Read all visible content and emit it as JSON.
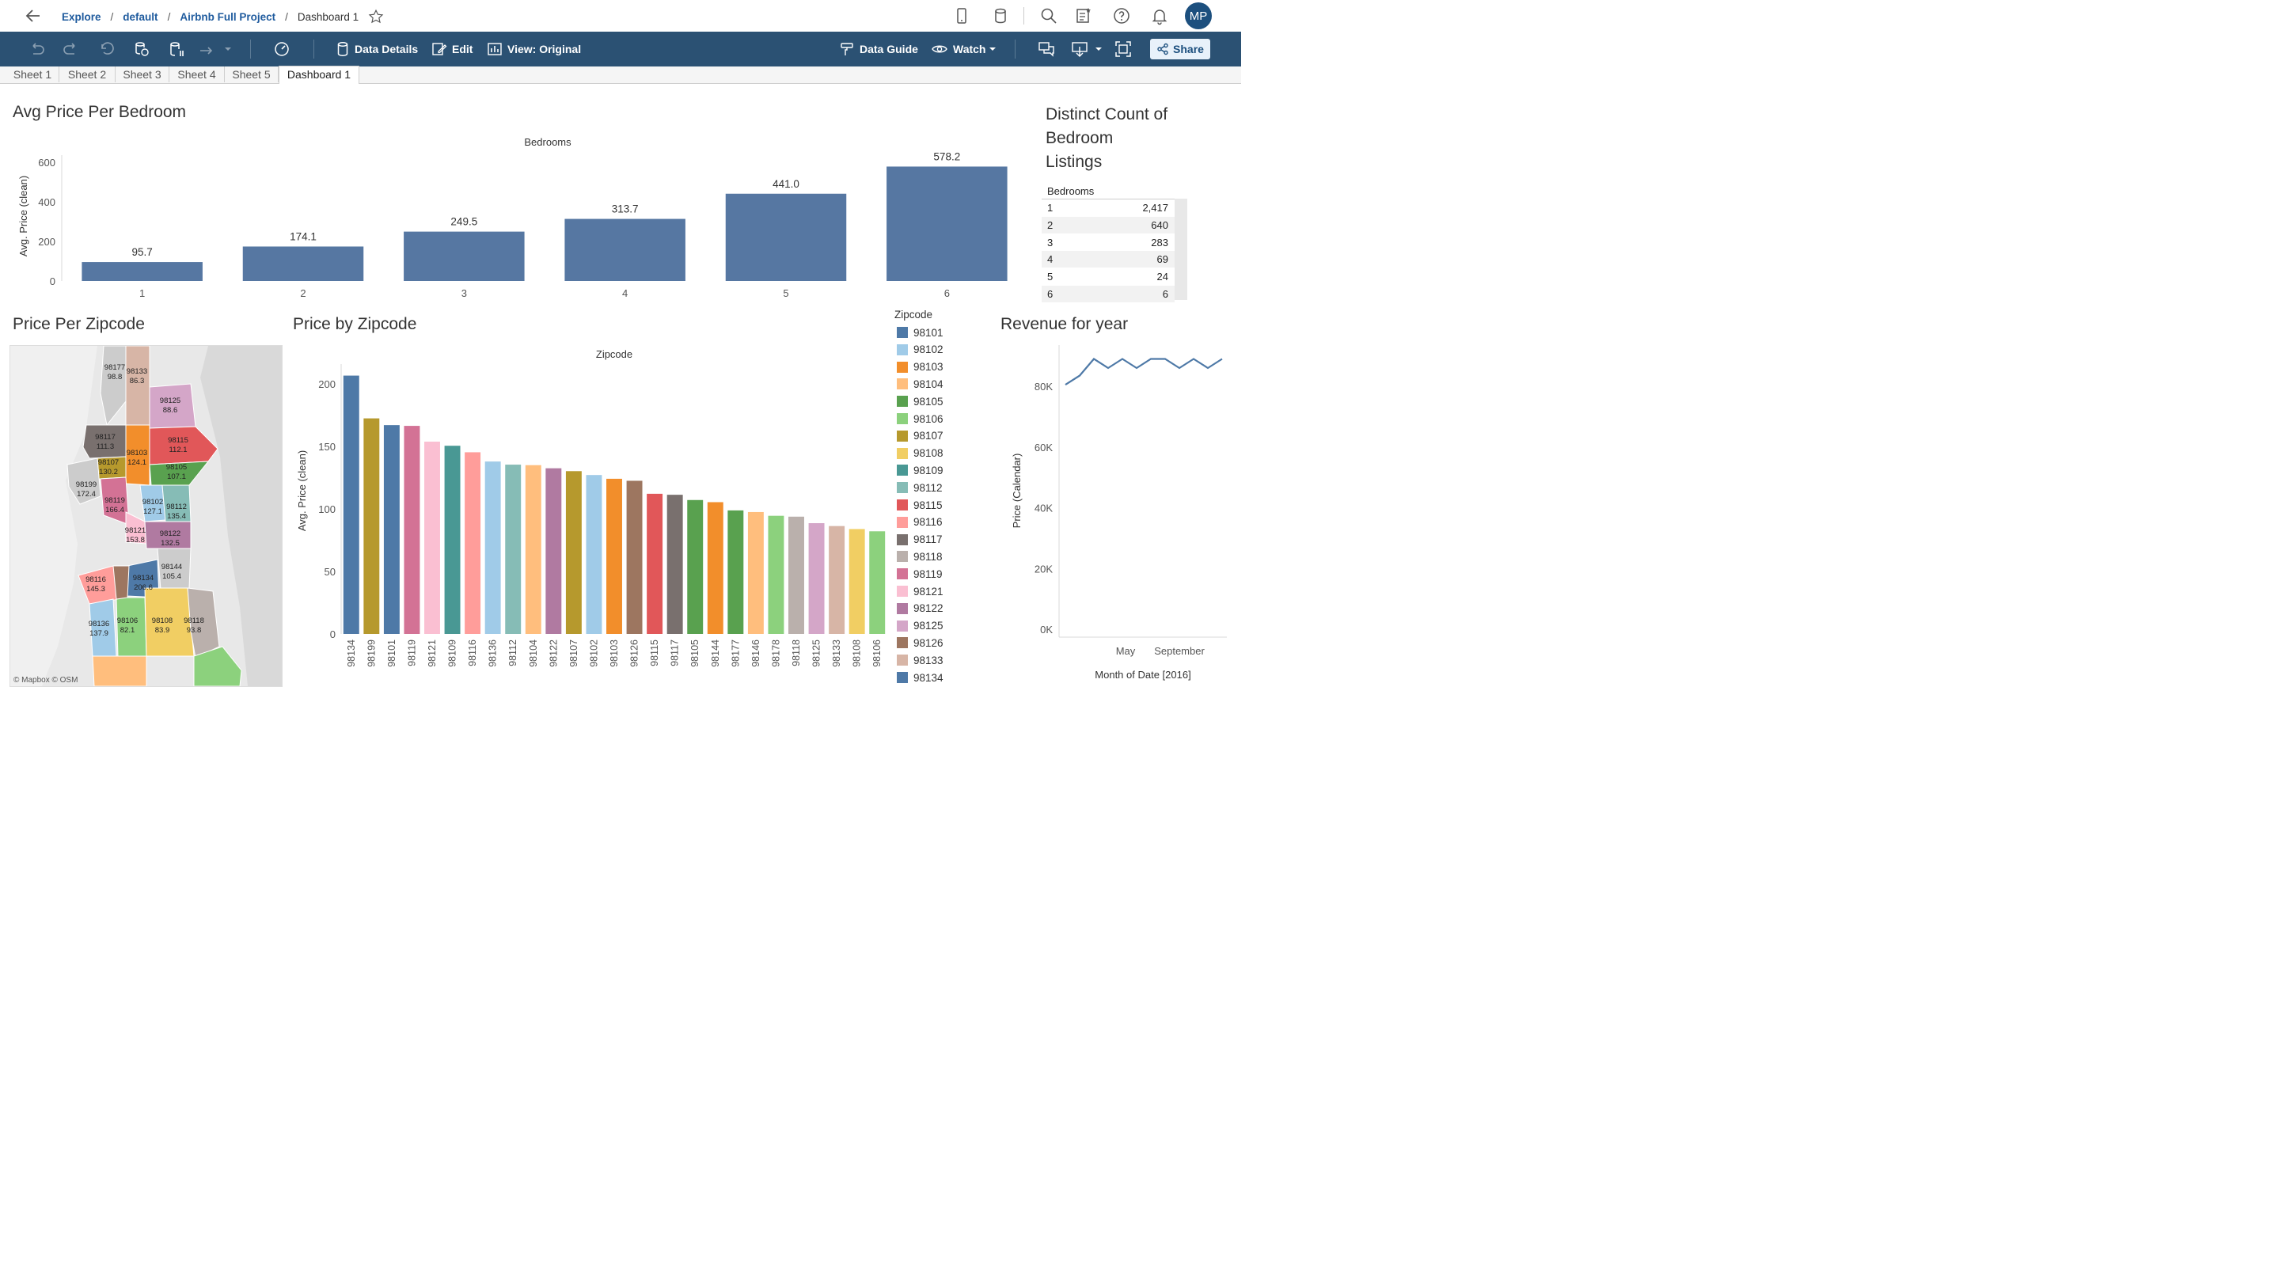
{
  "breadcrumb": {
    "items": [
      "Explore",
      "default",
      "Airbnb Full Project"
    ],
    "current": "Dashboard 1",
    "separator": "/"
  },
  "user": {
    "initials": "MP"
  },
  "toolbar": {
    "data_details": "Data Details",
    "edit": "Edit",
    "view": "View: Original",
    "data_guide": "Data Guide",
    "watch": "Watch",
    "share": "Share"
  },
  "tabs": [
    "Sheet 1",
    "Sheet 2",
    "Sheet 3",
    "Sheet 4",
    "Sheet 5",
    "Dashboard 1"
  ],
  "active_tab": "Dashboard 1",
  "titles": {
    "avg_price": "Avg Price Per Bedroom",
    "distinct_count": [
      "Distinct Count of",
      "Bedroom",
      "Listings"
    ],
    "price_per_zip": "Price Per Zipcode",
    "price_by_zip": "Price by Zipcode",
    "revenue": "Revenue for year"
  },
  "distinct_table": {
    "header": "Bedrooms",
    "rows": [
      {
        "key": "1",
        "value": "2,417"
      },
      {
        "key": "2",
        "value": "640"
      },
      {
        "key": "3",
        "value": "283"
      },
      {
        "key": "4",
        "value": "69"
      },
      {
        "key": "5",
        "value": "24"
      },
      {
        "key": "6",
        "value": "6"
      }
    ]
  },
  "legend": {
    "title": "Zipcode",
    "items": [
      {
        "zip": "98101",
        "color": "#4e79a7"
      },
      {
        "zip": "98102",
        "color": "#a0cbe8"
      },
      {
        "zip": "98103",
        "color": "#f28e2b"
      },
      {
        "zip": "98104",
        "color": "#ffbe7d"
      },
      {
        "zip": "98105",
        "color": "#59a14f"
      },
      {
        "zip": "98106",
        "color": "#8cd17d"
      },
      {
        "zip": "98107",
        "color": "#b6992d"
      },
      {
        "zip": "98108",
        "color": "#f1ce63"
      },
      {
        "zip": "98109",
        "color": "#499894"
      },
      {
        "zip": "98112",
        "color": "#86bcb6"
      },
      {
        "zip": "98115",
        "color": "#e15759"
      },
      {
        "zip": "98116",
        "color": "#ff9d9a"
      },
      {
        "zip": "98117",
        "color": "#79706e"
      },
      {
        "zip": "98118",
        "color": "#bab0ac"
      },
      {
        "zip": "98119",
        "color": "#d37295"
      },
      {
        "zip": "98121",
        "color": "#fabfd2"
      },
      {
        "zip": "98122",
        "color": "#b07aa1"
      },
      {
        "zip": "98125",
        "color": "#d4a6c8"
      },
      {
        "zip": "98126",
        "color": "#9d7660"
      },
      {
        "zip": "98133",
        "color": "#d7b5a6"
      },
      {
        "zip": "98134",
        "color": "#4e79a7"
      }
    ]
  },
  "map": {
    "credit": "© Mapbox  © OSM",
    "labels": [
      {
        "zip": "98177",
        "value": "98.8"
      },
      {
        "zip": "98133",
        "value": "86.3"
      },
      {
        "zip": "98125",
        "value": "88.6"
      },
      {
        "zip": "98117",
        "value": "111.3"
      },
      {
        "zip": "98103",
        "value": "124.1"
      },
      {
        "zip": "98115",
        "value": "112.1"
      },
      {
        "zip": "98107",
        "value": "130.2"
      },
      {
        "zip": "98105",
        "value": "107.1"
      },
      {
        "zip": "98199",
        "value": "172.4"
      },
      {
        "zip": "98119",
        "value": "166.4"
      },
      {
        "zip": "98102",
        "value": "127.1"
      },
      {
        "zip": "98112",
        "value": "135.4"
      },
      {
        "zip": "98121",
        "value": "153.8"
      },
      {
        "zip": "98122",
        "value": "132.5"
      },
      {
        "zip": "98116",
        "value": "145.3"
      },
      {
        "zip": "98134",
        "value": "206.6"
      },
      {
        "zip": "98144",
        "value": "105.4"
      },
      {
        "zip": "98136",
        "value": "137.9"
      },
      {
        "zip": "98106",
        "value": "82.1"
      },
      {
        "zip": "98108",
        "value": "83.9"
      },
      {
        "zip": "98118",
        "value": "93.8"
      }
    ]
  },
  "chart_data": [
    {
      "type": "bar",
      "title": "Avg Price Per Bedroom",
      "xlabel": "Bedrooms",
      "ylabel": "Avg. Price (clean)",
      "categories": [
        "1",
        "2",
        "3",
        "4",
        "5",
        "6"
      ],
      "values": [
        95.7,
        174.1,
        249.5,
        313.7,
        441.0,
        578.2
      ],
      "data_labels": [
        "95.7",
        "174.1",
        "249.5",
        "313.7",
        "441.0",
        "578.2"
      ],
      "yticks": [
        "0",
        "200",
        "400",
        "600"
      ],
      "ylim": [
        0,
        620
      ],
      "color": "#5677a2"
    },
    {
      "type": "bar",
      "title": "Price by Zipcode",
      "xlabel": "Zipcode",
      "ylabel": "Avg. Price (clean)",
      "categories": [
        "98134",
        "98199",
        "98101",
        "98119",
        "98121",
        "98109",
        "98116",
        "98136",
        "98112",
        "98104",
        "98122",
        "98107",
        "98102",
        "98103",
        "98126",
        "98115",
        "98117",
        "98105",
        "98144",
        "98177",
        "98146",
        "98178",
        "98118",
        "98125",
        "98133",
        "98108",
        "98106"
      ],
      "values": [
        206.6,
        172.4,
        167,
        166.4,
        153.8,
        150.5,
        145.3,
        137.9,
        135.4,
        135,
        132.5,
        130.2,
        127.1,
        124.1,
        122.5,
        112.1,
        111.3,
        107.1,
        105.4,
        98.8,
        97.5,
        94.5,
        93.8,
        88.6,
        86.3,
        83.9,
        82.1
      ],
      "colors": [
        "#4e79a7",
        "#b6992d",
        "#4e79a7",
        "#d37295",
        "#fabfd2",
        "#499894",
        "#ff9d9a",
        "#a0cbe8",
        "#86bcb6",
        "#ffbe7d",
        "#b07aa1",
        "#b6992d",
        "#a0cbe8",
        "#f28e2b",
        "#9d7660",
        "#e15759",
        "#79706e",
        "#59a14f",
        "#f28e2b",
        "#59a14f",
        "#ffbe7d",
        "#8cd17d",
        "#bab0ac",
        "#d4a6c8",
        "#d7b5a6",
        "#f1ce63",
        "#8cd17d"
      ],
      "yticks": [
        "0",
        "50",
        "100",
        "150",
        "200"
      ],
      "ylim": [
        0,
        210
      ]
    },
    {
      "type": "line",
      "title": "Revenue for year",
      "xlabel": "Month of Date [2016]",
      "ylabel": "Price (Calendar)",
      "x": [
        "Jan",
        "Feb",
        "Mar",
        "Apr",
        "May",
        "Jun",
        "Jul",
        "Aug",
        "Sep",
        "Oct",
        "Nov",
        "Dec"
      ],
      "values": [
        80500,
        83500,
        89000,
        86000,
        89000,
        86000,
        89000,
        89000,
        86000,
        89000,
        86000,
        89000
      ],
      "xticks": [
        "May",
        "September"
      ],
      "yticks": [
        "0K",
        "20K",
        "40K",
        "60K",
        "80K"
      ],
      "ylim": [
        0,
        92000
      ],
      "color": "#4e79a7"
    }
  ]
}
